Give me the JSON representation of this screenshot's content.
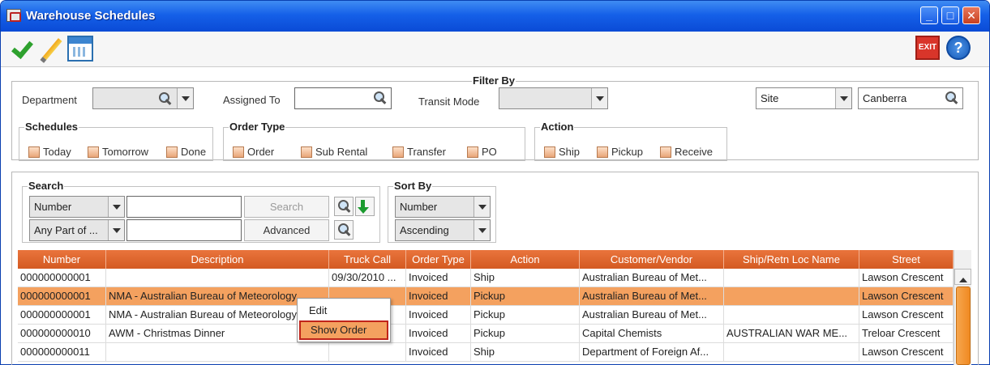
{
  "window": {
    "title": "Warehouse Schedules",
    "min": "_",
    "max": "□",
    "close": "✕"
  },
  "toolbar": {
    "exit_label": "EXIT",
    "help_label": "?"
  },
  "filter": {
    "title": "Filter By",
    "department_label": "Department",
    "assigned_label": "Assigned To",
    "transit_label": "Transit Mode",
    "site_value": "Site",
    "site_name": "Canberra",
    "schedules": {
      "title": "Schedules",
      "options": [
        "Today",
        "Tomorrow",
        "Done"
      ]
    },
    "order_type": {
      "title": "Order Type",
      "options": [
        "Order",
        "Sub Rental",
        "Transfer",
        "PO"
      ]
    },
    "action": {
      "title": "Action",
      "options": [
        "Ship",
        "Pickup",
        "Receive"
      ]
    }
  },
  "search": {
    "title": "Search",
    "field_value": "Number",
    "match_value": "Any Part of ...",
    "search_button": "Search",
    "advanced_button": "Advanced"
  },
  "sort": {
    "title": "Sort By",
    "field_value": "Number",
    "order_value": "Ascending"
  },
  "grid": {
    "columns": [
      "Number",
      "Description",
      "Truck Call",
      "Order Type",
      "Action",
      "Customer/Vendor",
      "Ship/Retn Loc Name",
      "Street"
    ],
    "rows": [
      [
        "000000000001",
        "",
        "09/30/2010 ...",
        "Invoiced",
        "Ship",
        "Australian Bureau of Met...",
        "",
        "Lawson Crescent"
      ],
      [
        "000000000001",
        "NMA - Australian Bureau of Meteorology",
        "",
        "Invoiced",
        "Pickup",
        "Australian Bureau of Met...",
        "",
        "Lawson Crescent"
      ],
      [
        "000000000001",
        "NMA - Australian Bureau of Meteorology",
        "",
        "Invoiced",
        "Pickup",
        "Australian Bureau of Met...",
        "",
        "Lawson Crescent"
      ],
      [
        "000000000010",
        "AWM - Christmas Dinner",
        "",
        "Invoiced",
        "Pickup",
        "Capital Chemists",
        "AUSTRALIAN WAR ME...",
        "Treloar Crescent"
      ],
      [
        "000000000011",
        "",
        "",
        "Invoiced",
        "Ship",
        "Department of Foreign Af...",
        "",
        "Lawson Crescent"
      ]
    ]
  },
  "context_menu": {
    "items": [
      "Edit",
      "Show Order"
    ]
  }
}
